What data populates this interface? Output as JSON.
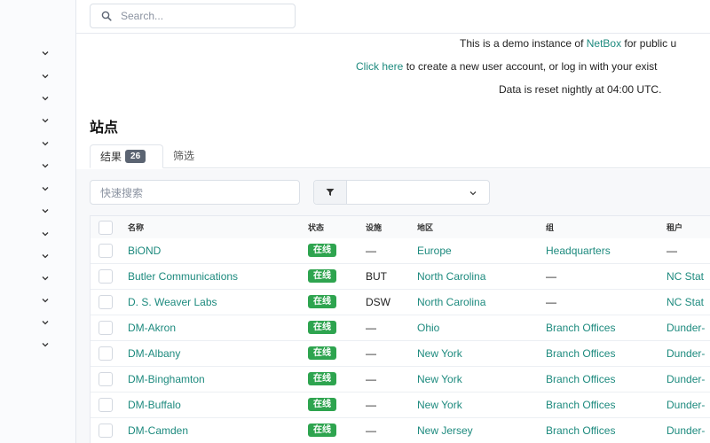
{
  "search": {
    "placeholder": "Search..."
  },
  "banner": {
    "line1_prefix": "This is a demo instance of ",
    "line1_link": "NetBox",
    "line1_suffix": " for public u",
    "line2_link": "Click here",
    "line2_suffix": " to create a new user account, or log in with your exist",
    "line3": "Data is reset nightly at 04:00 UTC."
  },
  "page": {
    "title": "站点"
  },
  "tabs": [
    {
      "label": "结果",
      "count": "26"
    },
    {
      "label": "筛选"
    }
  ],
  "quick_search": {
    "placeholder": "快速搜索"
  },
  "table": {
    "columns": [
      "名称",
      "状态",
      "设施",
      "地区",
      "组",
      "租户"
    ],
    "rows": [
      {
        "name": "BiOND",
        "status": "在线",
        "facility": "—",
        "region": "Europe",
        "group": "Headquarters",
        "tenant": "—"
      },
      {
        "name": "Butler Communications",
        "status": "在线",
        "facility": "BUT",
        "region": "North Carolina",
        "group": "—",
        "tenant": "NC Stat"
      },
      {
        "name": "D. S. Weaver Labs",
        "status": "在线",
        "facility": "DSW",
        "region": "North Carolina",
        "group": "—",
        "tenant": "NC Stat"
      },
      {
        "name": "DM-Akron",
        "status": "在线",
        "facility": "—",
        "region": "Ohio",
        "group": "Branch Offices",
        "tenant": "Dunder-"
      },
      {
        "name": "DM-Albany",
        "status": "在线",
        "facility": "—",
        "region": "New York",
        "group": "Branch Offices",
        "tenant": "Dunder-"
      },
      {
        "name": "DM-Binghamton",
        "status": "在线",
        "facility": "—",
        "region": "New York",
        "group": "Branch Offices",
        "tenant": "Dunder-"
      },
      {
        "name": "DM-Buffalo",
        "status": "在线",
        "facility": "—",
        "region": "New York",
        "group": "Branch Offices",
        "tenant": "Dunder-"
      },
      {
        "name": "DM-Camden",
        "status": "在线",
        "facility": "—",
        "region": "New Jersey",
        "group": "Branch Offices",
        "tenant": "Dunder-"
      }
    ]
  },
  "colors": {
    "accent": "#1d8a7e",
    "status_active": "#2ea44f",
    "badge": "#5b6472"
  },
  "icons": {
    "search": "search-icon",
    "filter": "filter-icon",
    "chevron": "chevron-down-icon"
  }
}
